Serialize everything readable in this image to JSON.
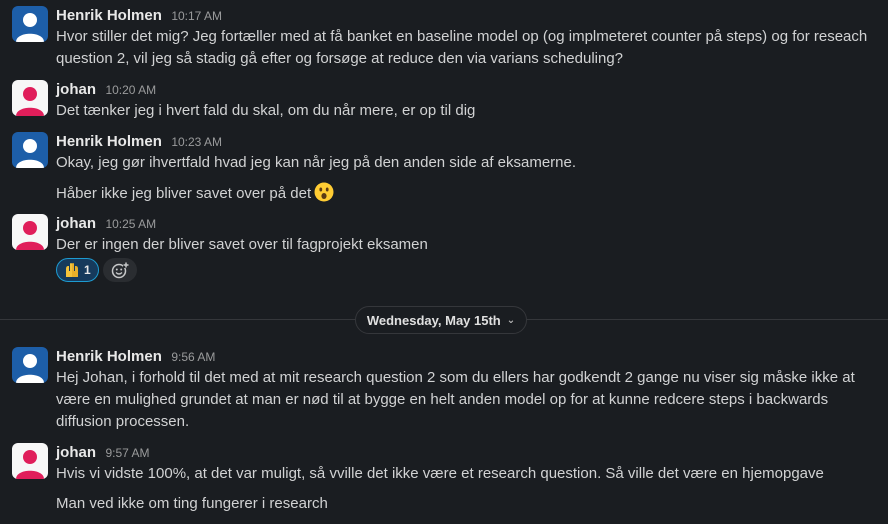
{
  "messages": [
    {
      "author": "Henrik Holmen",
      "time": "10:17 AM",
      "lines": [
        "Hvor stiller det mig? Jeg fortæller med at få banket en baseline model op (og implmeteret counter på steps) og for reseach",
        "question 2, vil jeg så stadig gå efter og forsøge at reduce den via varians scheduling?"
      ]
    },
    {
      "author": "johan",
      "time": "10:20 AM",
      "lines": [
        "Det tænker jeg i hvert fald du skal, om du når mere, er op til dig"
      ]
    },
    {
      "author": "Henrik Holmen",
      "time": "10:23 AM",
      "lines": [
        "Okay, jeg gør ihvertfald hvad jeg kan når jeg på den anden side af eksamerne."
      ],
      "followup": "Håber ikke jeg bliver savet over på det",
      "followup_emoji": "astonished-face-icon"
    },
    {
      "author": "johan",
      "time": "10:25 AM",
      "lines": [
        "Der er ingen der bliver savet over til fagprojekt eksamen"
      ],
      "reactions": [
        {
          "emoji": "raised-hands-icon",
          "count": "1"
        }
      ]
    },
    {
      "author": "Henrik Holmen",
      "time": "9:56 AM",
      "lines": [
        "Hej Johan, i forhold til det med at mit research question 2 som du ellers har godkendt 2 gange nu viser sig måske ikke at",
        "være en mulighed grundet at man er nød til at bygge en helt anden model op for at kunne redcere steps i backwards",
        "diffusion processen."
      ]
    },
    {
      "author": "johan",
      "time": "9:57 AM",
      "lines": [
        "Hvis vi vidste 100%, at det var muligt, så vville det ikke være et research question. Så ville det være en hjemopgave"
      ],
      "followup": "Man ved ikke om ting fungerer i research"
    }
  ],
  "date_divider": {
    "label": "Wednesday, May 15th",
    "icon": "chevron-down-icon"
  },
  "colors": {
    "background": "#1a1d21",
    "henrik_avatar_bg": "#1d5ea8",
    "johan_avatar_bg": "#f7f7f7",
    "johan_avatar_fg": "#e01e5a",
    "reaction_bg": "#163a5c",
    "reaction_border": "#1d9bd1"
  }
}
